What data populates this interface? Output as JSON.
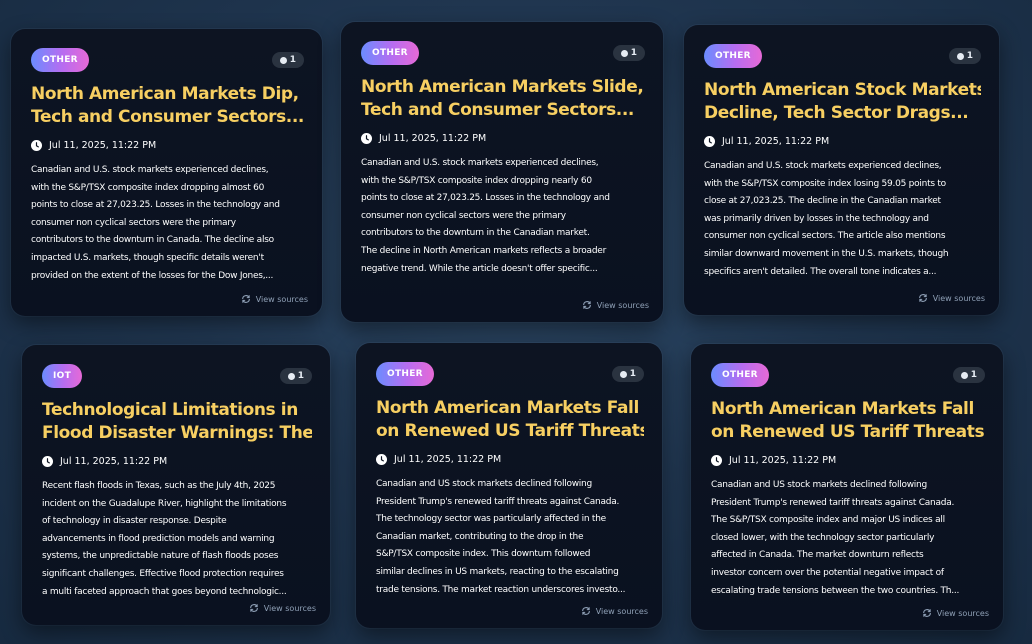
{
  "cards": [
    {
      "tag": "OTHER",
      "count": "1",
      "title_lines": [
        "North American Markets Dip,",
        "Tech and Consumer Sectors..."
      ],
      "date": "Jul 11, 2025, 11:22 PM",
      "summary_lines": [
        "Canadian and U.S. stock markets experienced declines,",
        "with the S&P/TSX composite index dropping almost 60",
        "points to close at 27,023.25. Losses in the technology and",
        "consumer non cyclical sectors were the primary",
        "contributors to the downturn in Canada. The decline also",
        "impacted U.S. markets, though specific details weren't",
        "provided on the extent of the losses for the Dow Jones,..."
      ],
      "sources_label": "View sources"
    },
    {
      "tag": "OTHER",
      "count": "1",
      "title_lines": [
        "North American Markets Slide,",
        "Tech and Consumer Sectors..."
      ],
      "date": "Jul 11, 2025, 11:22 PM",
      "summary_lines": [
        "Canadian and U.S. stock markets experienced declines,",
        "with the S&P/TSX composite index dropping nearly 60",
        "points to close at 27,023.25. Losses in the technology and",
        "consumer non cyclical sectors were the primary",
        "contributors to the downturn in the Canadian market.",
        "The decline in North American markets reflects a broader",
        "negative trend. While the article doesn't offer specific..."
      ],
      "sources_label": "View sources"
    },
    {
      "tag": "OTHER",
      "count": "1",
      "title_lines": [
        "North American Stock Markets",
        "Decline, Tech Sector Drags..."
      ],
      "date": "Jul 11, 2025, 11:22 PM",
      "summary_lines": [
        "Canadian and U.S. stock markets experienced declines,",
        "with the S&P/TSX composite index losing 59.05 points to",
        "close at 27,023.25. The decline in the Canadian market",
        "was primarily driven by losses in the technology and",
        "consumer non cyclical sectors. The article also mentions",
        "similar downward movement in the U.S. markets, though",
        "specifics aren't detailed. The overall tone indicates a..."
      ],
      "sources_label": "View sources"
    },
    {
      "tag": "IOT",
      "count": "1",
      "title_lines": [
        "Technological Limitations in",
        "Flood Disaster Warnings: The..."
      ],
      "date": "Jul 11, 2025, 11:22 PM",
      "summary_lines": [
        "Recent flash floods in Texas, such as the July 4th, 2025",
        "incident on the Guadalupe River, highlight the limitations",
        "of technology in disaster response. Despite",
        "advancements in flood prediction models and warning",
        "systems, the unpredictable nature of flash floods poses",
        "significant challenges. Effective flood protection requires",
        "a multi faceted approach that goes beyond technologic..."
      ],
      "sources_label": "View sources"
    },
    {
      "tag": "OTHER",
      "count": "1",
      "title_lines": [
        "North American Markets Fall",
        "on Renewed US Tariff Threats..."
      ],
      "date": "Jul 11, 2025, 11:22 PM",
      "summary_lines": [
        "Canadian and US stock markets declined following",
        "President Trump's renewed tariff threats against Canada.",
        "The technology sector was particularly affected in the",
        "Canadian market, contributing to the drop in the",
        "S&P/TSX composite index. This downturn followed",
        "similar declines in US markets, reacting to the escalating",
        "trade tensions. The market reaction underscores investo..."
      ],
      "sources_label": "View sources"
    },
    {
      "tag": "OTHER",
      "count": "1",
      "title_lines": [
        "North American Markets Fall",
        "on Renewed US Tariff Threats..."
      ],
      "date": "Jul 11, 2025, 11:22 PM",
      "summary_lines": [
        "Canadian and US stock markets declined following",
        "President Trump's renewed tariff threats against Canada.",
        "The S&P/TSX composite index and major US indices all",
        "closed lower, with the technology sector particularly",
        "affected in Canada. The market downturn reflects",
        "investor concern over the potential negative impact of",
        "escalating trade tensions between the two countries. Th..."
      ],
      "sources_label": "View sources"
    }
  ]
}
